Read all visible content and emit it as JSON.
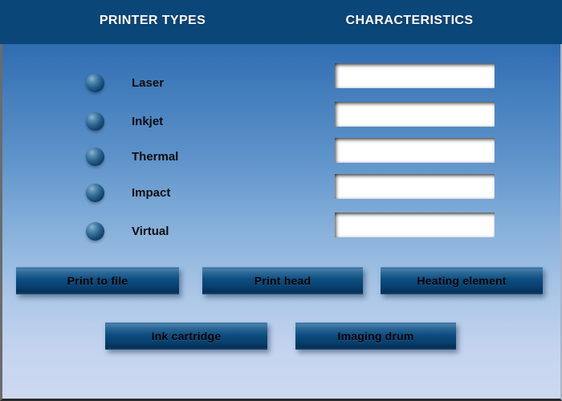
{
  "header": {
    "left_title": "PRINTER TYPES",
    "right_title": "CHARACTERISTICS",
    "background_color": "#0b4679",
    "text_color": "#ffffff"
  },
  "theme": {
    "panel_gradient_top": "#2f6cb0",
    "panel_gradient_bottom": "#ccd8ef",
    "button_fill_dark": "#07406f",
    "button_fill_light": "#4a80ab",
    "bullet_highlight": "#8fb6cf",
    "bullet_shadow": "#04203a"
  },
  "printer_types": [
    {
      "label": "Laser",
      "bullet": "sphere-bullet-icon",
      "answer_value": "",
      "answer_placeholder": ""
    },
    {
      "label": "Inkjet",
      "bullet": "sphere-bullet-icon",
      "answer_value": "",
      "answer_placeholder": ""
    },
    {
      "label": "Thermal",
      "bullet": "sphere-bullet-icon",
      "answer_value": "",
      "answer_placeholder": ""
    },
    {
      "label": "Impact",
      "bullet": "sphere-bullet-icon",
      "answer_value": "",
      "answer_placeholder": ""
    },
    {
      "label": "Virtual",
      "bullet": "sphere-bullet-icon",
      "answer_value": "",
      "answer_placeholder": ""
    }
  ],
  "answer_buttons": {
    "row1": [
      {
        "label": "Print to file"
      },
      {
        "label": "Print head"
      },
      {
        "label": "Heating element"
      }
    ],
    "row2": [
      {
        "label": "Ink cartridge"
      },
      {
        "label": "Imaging drum"
      }
    ]
  }
}
